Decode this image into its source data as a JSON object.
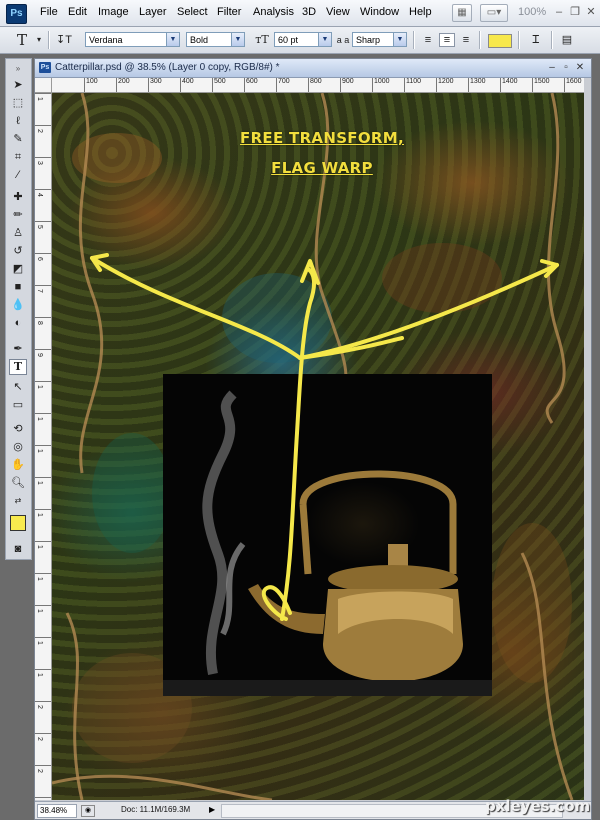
{
  "app": {
    "logo": "Ps"
  },
  "menu": [
    "File",
    "Edit",
    "Image",
    "Layer",
    "Select",
    "Filter",
    "Analysis",
    "3D",
    "View",
    "Window",
    "Help"
  ],
  "menubar_right": {
    "zoom_display": "100%",
    "icons": [
      "bridge-icon",
      "screen-mode-icon"
    ]
  },
  "options_bar": {
    "tool_glyph": "T",
    "font_family": "Verdana",
    "font_style": "Bold",
    "font_size": "60 pt",
    "aa_label": "a a",
    "antialias": "Sharp",
    "text_color": "#f7e84c",
    "icons": [
      "orient-text-icon",
      "align-left-icon",
      "align-center-icon",
      "align-right-icon",
      "warp-text-icon",
      "character-panel-icon"
    ]
  },
  "tools_panel": {
    "active_tool": "type-tool",
    "foreground_color": "#f8ea4e",
    "background_color": "#ffffff"
  },
  "document": {
    "title": "Catterpillar.psd @ 38.5% (Layer 0 copy, RGB/8#) *",
    "horizontal_ruler": [
      "100",
      "200",
      "300",
      "400",
      "500",
      "600",
      "700",
      "800",
      "900",
      "1000",
      "1100",
      "1200",
      "1300",
      "1400",
      "1500",
      "1600"
    ],
    "vertical_ruler": [
      "1",
      "2",
      "3",
      "4",
      "5",
      "6",
      "7",
      "8",
      "9",
      "1",
      "1",
      "1",
      "1",
      "1",
      "1",
      "1",
      "1",
      "1",
      "1",
      "2",
      "2",
      "2",
      "2"
    ],
    "canvas_text_line1": "FREE TRANSFORM,",
    "canvas_text_line2": "FLAG WARP",
    "annotation_color": "#f5e84a"
  },
  "status_bar": {
    "zoom": "38.48%",
    "doc_info": "Doc: 11.1M/169.3M"
  },
  "watermark": "pxleyes.com"
}
